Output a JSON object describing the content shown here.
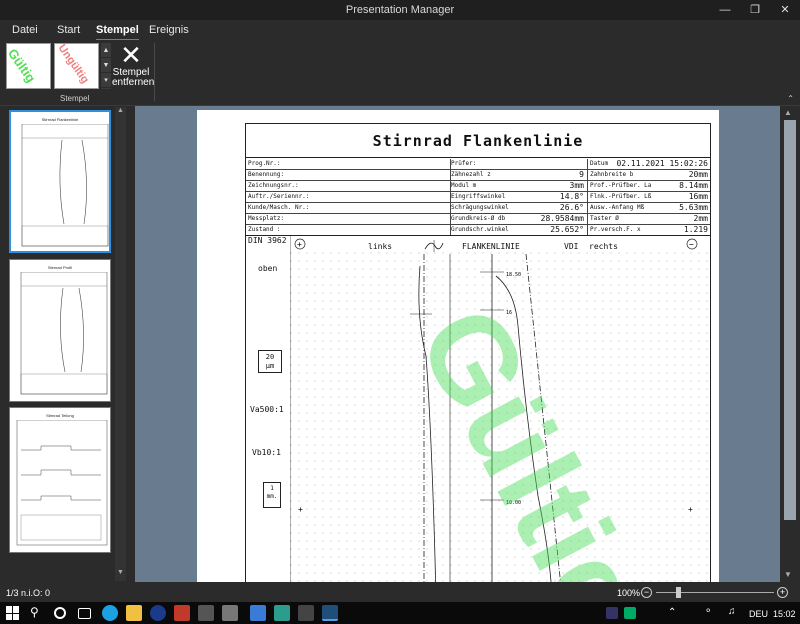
{
  "window": {
    "title": "Presentation Manager"
  },
  "menu": {
    "items": [
      "Datei",
      "Start",
      "Stempel",
      "Ereignis"
    ],
    "active": "Stempel"
  },
  "ribbon": {
    "stamp1": "Gültig",
    "stamp2": "Ungültig",
    "remove_label_1": "Stempel",
    "remove_label_2": "entfernen",
    "group_label": "Stempel"
  },
  "thumbnails": {
    "t1": "Stirnrad Flankenlinie",
    "t2": "Stirnrad Profil",
    "t3": "Stirnrad Teilung"
  },
  "doc": {
    "title": "Stirnrad Flankenlinie",
    "left_rows": [
      [
        "Prog.Nr.:",
        ""
      ],
      [
        "Benennung:",
        ""
      ],
      [
        "Zeichnungsnr.:",
        ""
      ],
      [
        "Auftr./Seriennr.:",
        ""
      ],
      [
        "Kunde/Masch. Nr.:",
        ""
      ],
      [
        "Messplatz:",
        ""
      ],
      [
        "Zustand :",
        ""
      ]
    ],
    "mid_rows": [
      [
        "Prüfer:",
        ""
      ],
      [
        "Zähnezahl z",
        "9"
      ],
      [
        "Modul m",
        "3mm"
      ],
      [
        "Eingriffswinkel",
        "14.8°"
      ],
      [
        "Schrägungswinkel",
        "26.6°"
      ],
      [
        "Grundkreis-Ø db",
        "28.9584mm"
      ],
      [
        "Grundschr.winkel",
        "25.652°"
      ]
    ],
    "right_rows": [
      [
        "Datum",
        "02.11.2021  15:02:26"
      ],
      [
        "Zahnbreite b",
        "20mm"
      ],
      [
        "Prof.-Prüfber. La",
        "8.14mm"
      ],
      [
        "Flnk.-Prüfber. Lß",
        "16mm"
      ],
      [
        "Ausw.-Anfang Mß",
        "5.63mm"
      ],
      [
        "Taster Ø",
        "2mm"
      ],
      [
        "Pr.versch.F. x",
        "1.219"
      ]
    ],
    "din": "DIN 3962",
    "links": "links",
    "flankenlinie": "FLANKENLINIE",
    "vdi": "VDI",
    "rechts": "rechts",
    "oben": "oben",
    "scale_box": "20",
    "scale_unit": "µm",
    "va": "Va500:1",
    "vb": "Vb10:1",
    "mm_box": "1",
    "mm_unit": "mm.",
    "mark_top": "18.50",
    "mark_mid": "16",
    "mark_low": "10.00",
    "stamp_text": "Gültig"
  },
  "status": {
    "page": "1/3 n.i.O: 0",
    "zoom": "100%"
  },
  "taskbar": {
    "lang": "DEU",
    "time": "15:02"
  }
}
